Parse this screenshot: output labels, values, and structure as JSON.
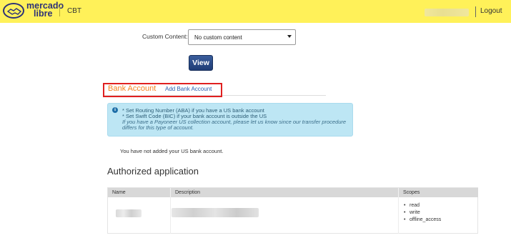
{
  "header": {
    "logo_line1": "mercado",
    "logo_line2": "libre",
    "site": "CBT",
    "logout": "Logout"
  },
  "form": {
    "custom_content_label": "Custom Content:",
    "custom_content_value": "No custom content",
    "view_button": "View"
  },
  "bank": {
    "title": "Bank Account",
    "add_link": "Add Bank Account",
    "info_lines": [
      "* Set Routing Number (ABA) if you have a US bank account",
      "* Set Swift Code (BIC) if your bank account is outside the US",
      "If you have a Payoneer US collection account, please let us know since our transfer procedure",
      "differs for this type of account."
    ],
    "no_account_text": "You have not added your US bank account."
  },
  "authorized": {
    "title": "Authorized application",
    "columns": [
      "Name",
      "Description",
      "Scopes"
    ],
    "scopes": [
      "read",
      "write",
      "offline_access"
    ]
  },
  "colors": {
    "header_bg": "#fff159",
    "accent_orange": "#f58220",
    "link_blue": "#2a5db0",
    "info_bg": "#bde6f4",
    "button_blue": "#1f3d76",
    "highlight_red": "#e02020"
  }
}
